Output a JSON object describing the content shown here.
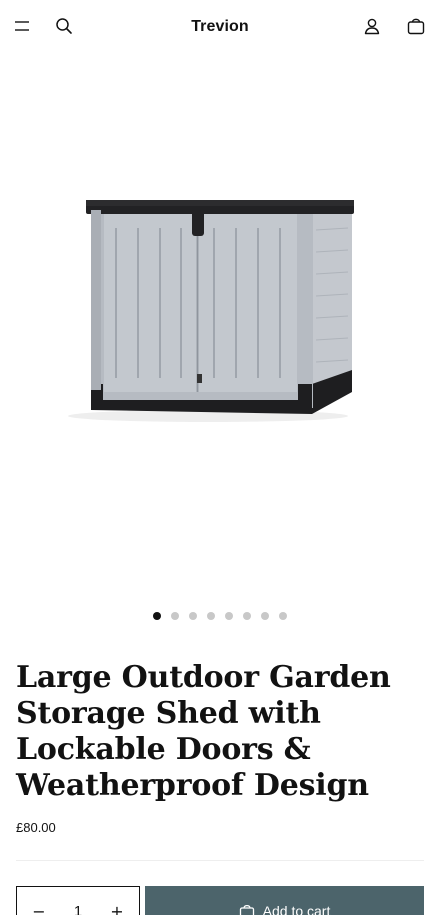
{
  "header": {
    "brand": "Trevion",
    "icons": [
      "menu-icon",
      "search-icon",
      "account-icon",
      "cart-icon"
    ]
  },
  "gallery": {
    "image_alt": "Large Outdoor Garden Storage Shed",
    "slide_count": 8,
    "active_slide": 1
  },
  "product": {
    "title": "Large Outdoor Garden Storage Shed with Lockable Doors & Weatherproof Design",
    "price": "£80.00"
  },
  "purchase": {
    "quantity": "1",
    "minus_label": "−",
    "plus_label": "+",
    "add_to_cart_label": "Add to cart"
  },
  "colors": {
    "button_bg": "#4c646b",
    "text": "#121212",
    "dot_inactive": "#c8c8c8"
  }
}
